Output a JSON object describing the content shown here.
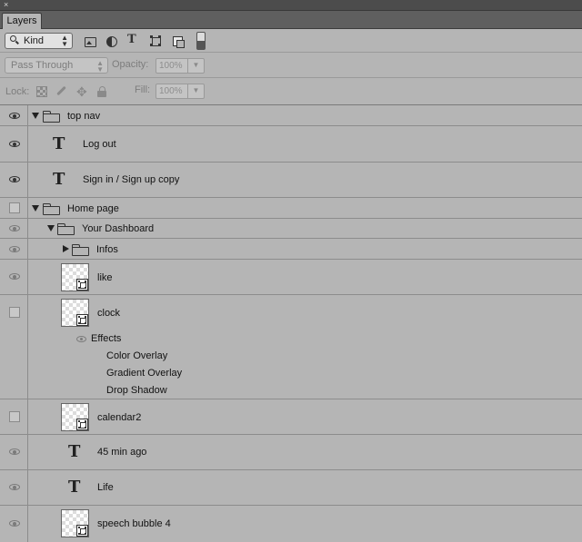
{
  "window": {
    "close_glyph": "×",
    "tab_label": "Layers"
  },
  "filter": {
    "kind_label": "Kind",
    "icons": [
      "pixel-layer-filter-icon",
      "adjustment-layer-filter-icon",
      "type-layer-filter-icon",
      "shape-layer-filter-icon",
      "smart-object-filter-icon"
    ],
    "type_glyph": "T"
  },
  "blend": {
    "mode": "Pass Through",
    "opacity_label": "Opacity:",
    "opacity_value": "100%",
    "fill_label": "Fill:",
    "fill_value": "100%"
  },
  "lock": {
    "label": "Lock:",
    "move_glyph": "✥"
  },
  "layers": [
    {
      "name": "top nav",
      "kind": "group",
      "visible": true
    },
    {
      "name": "Log out",
      "kind": "text",
      "visible": true,
      "glyph": "T"
    },
    {
      "name": "Sign in / Sign up copy",
      "kind": "text",
      "visible": true,
      "glyph": "T"
    },
    {
      "name": "Home page",
      "kind": "group",
      "visible": false
    },
    {
      "name": "Your Dashboard",
      "kind": "group",
      "visible": "dim"
    },
    {
      "name": "Infos",
      "kind": "group-collapsed",
      "visible": "dim"
    },
    {
      "name": "like",
      "kind": "smart-object",
      "visible": "dim"
    },
    {
      "name": "clock",
      "kind": "smart-object",
      "visible": false,
      "effects_label": "Effects",
      "effects": [
        "Color Overlay",
        "Gradient Overlay",
        "Drop Shadow"
      ]
    },
    {
      "name": "calendar2",
      "kind": "smart-object",
      "visible": false
    },
    {
      "name": "45 min ago",
      "kind": "text",
      "visible": "dim",
      "glyph": "T"
    },
    {
      "name": "Life",
      "kind": "text",
      "visible": "dim",
      "glyph": "T"
    },
    {
      "name": "speech bubble 4",
      "kind": "smart-object",
      "visible": "dim"
    }
  ],
  "colors": {
    "panel": "#b5b5b5",
    "titlebar": "#4c4c4c",
    "tabbar": "#5f5f5f",
    "divider": "#8c8c8c"
  }
}
